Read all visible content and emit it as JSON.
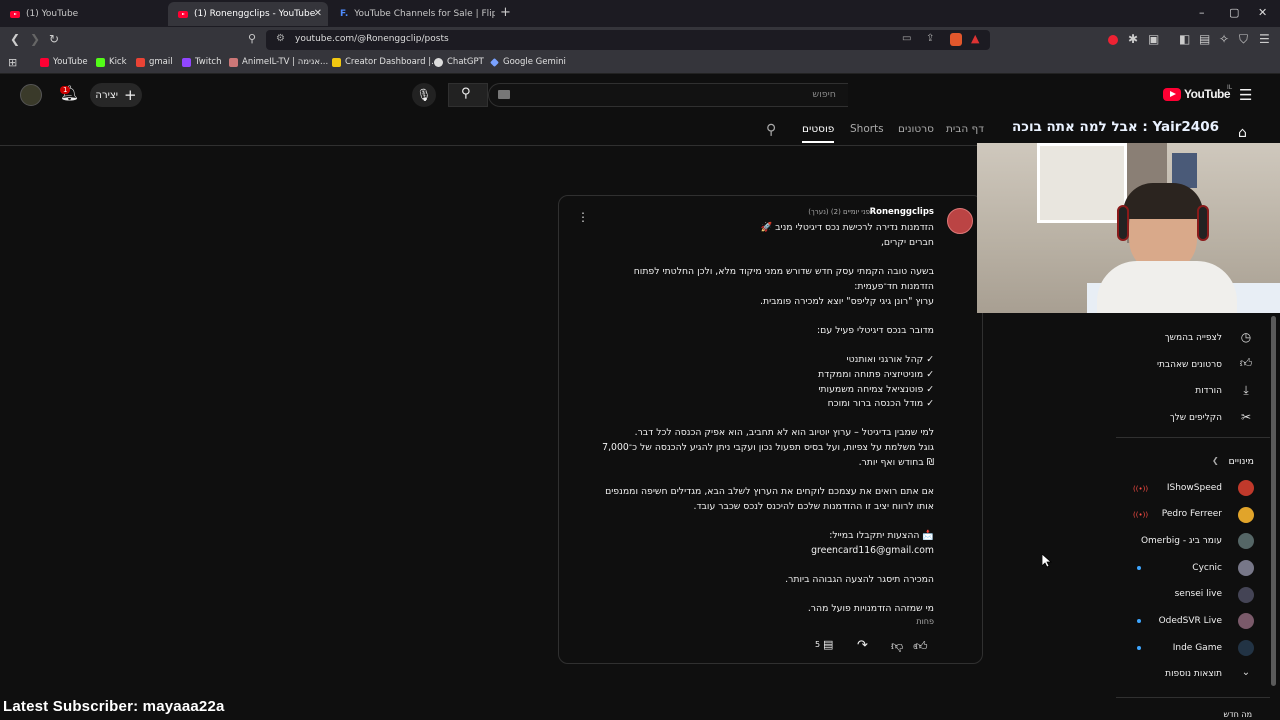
{
  "browser": {
    "tabs": [
      {
        "label": "(1) YouTube"
      },
      {
        "label": "(1) Ronenggclips - YouTube"
      },
      {
        "label": "YouTube Channels for Sale | Flippa"
      }
    ],
    "url": "youtube.com/@Ronenggclip/posts",
    "bookmarks": [
      "YouTube",
      "Kick",
      "gmail",
      "Twitch",
      "AnimeIL-TV | אנימה...",
      "Creator Dashboard |...",
      "ChatGPT",
      "Google Gemini"
    ]
  },
  "header": {
    "logo": "YouTube",
    "logo_suffix": "IL",
    "search_placeholder": "חיפוש",
    "create_label": "יצירה",
    "notification_count": "1"
  },
  "channel_tabs": {
    "home_label": "דף הבית",
    "videos": "דף הבית",
    "shorts_videos": "סרטונים",
    "shorts": "Shorts",
    "posts": "פוסטים",
    "stream_title": "Yair2406 : אבל למה אתה בוכה"
  },
  "post": {
    "author": "Ronenggclips",
    "meta": "לפני יומיים (2) (נערך)",
    "lines": [
      "הזדמנות נדירה לרכישת נכס דיגיטלי מניב 🚀",
      "חברים יקרים,",
      "",
      "בשעה טובה הקמתי עסק חדש שדורש ממני מיקוד מלא, ולכן החלטתי לפתוח",
      "הזדמנות חד־פעמית:",
      "ערוץ \"רונן גיגי קליפס\" יוצא למכירה פומבית.",
      "",
      "מדובר בנכס דיגיטלי פעיל עם:",
      "",
      "✓ קהל אורגני ואותנטי",
      "✓ מוניטיזציה פתוחה וממקדת",
      "✓ פוטנציאל צמיחה משמעותי",
      "✓ מודל הכנסה ברור ומוכח",
      "",
      "למי שמבין בדיגיטל – ערוץ יוטיוב הוא לא תחביב, הוא אפיק הכנסה לכל דבר.",
      "גוגל משלמת על צפיות, ועל בסיס תפעול נכון ועקבי ניתן להגיע להכנסה של כ־7,000",
      "₪ בחודש ואף יותר.",
      "",
      "אם אתם רואים את עצמכם לוקחים את הערוץ לשלב הבא, מגדילים חשיפה וממנפים",
      "אותו לרווח יציב זו ההזדמנות שלכם להיכנס לנכס שכבר עובד.",
      "",
      "📩 ההצעות יתקבלו במייל:",
      "greencard116@gmail.com",
      "",
      "המכירה תיסגר להצעה הגבוהה ביותר.",
      "",
      "מי שמזהה הזדמנויות פועל מהר."
    ],
    "less_label": "פחות",
    "likes": "6",
    "comments": "5"
  },
  "sidebar": {
    "items": [
      {
        "label": "לצפייה בהמשך",
        "icon": "clock-icon"
      },
      {
        "label": "סרטונים שאהבתי",
        "icon": "thumb-up-icon"
      },
      {
        "label": "הורדות",
        "icon": "download-icon"
      },
      {
        "label": "הקליפים שלך",
        "icon": "scissors-icon"
      }
    ],
    "subscriptions_title": "מינויים",
    "subscriptions": [
      {
        "name": "IShowSpeed",
        "color": "#c0392b"
      },
      {
        "name": "Pedro Ferreer",
        "color": "#e1a42a"
      },
      {
        "name": "עומר ביג - Omerbig",
        "color": "#566"
      },
      {
        "name": "Cycnic",
        "color": "#778"
      },
      {
        "name": "sensei live",
        "color": "#445"
      },
      {
        "name": "OdedSVR Live",
        "color": "#7a5a6a"
      },
      {
        "name": "Inde Game",
        "color": "#234"
      }
    ],
    "show_more": "תוצאות נוספות",
    "bottom_label": "מה חדש"
  },
  "overlay": {
    "text": "Latest Subscriber: mayaaa22a"
  }
}
